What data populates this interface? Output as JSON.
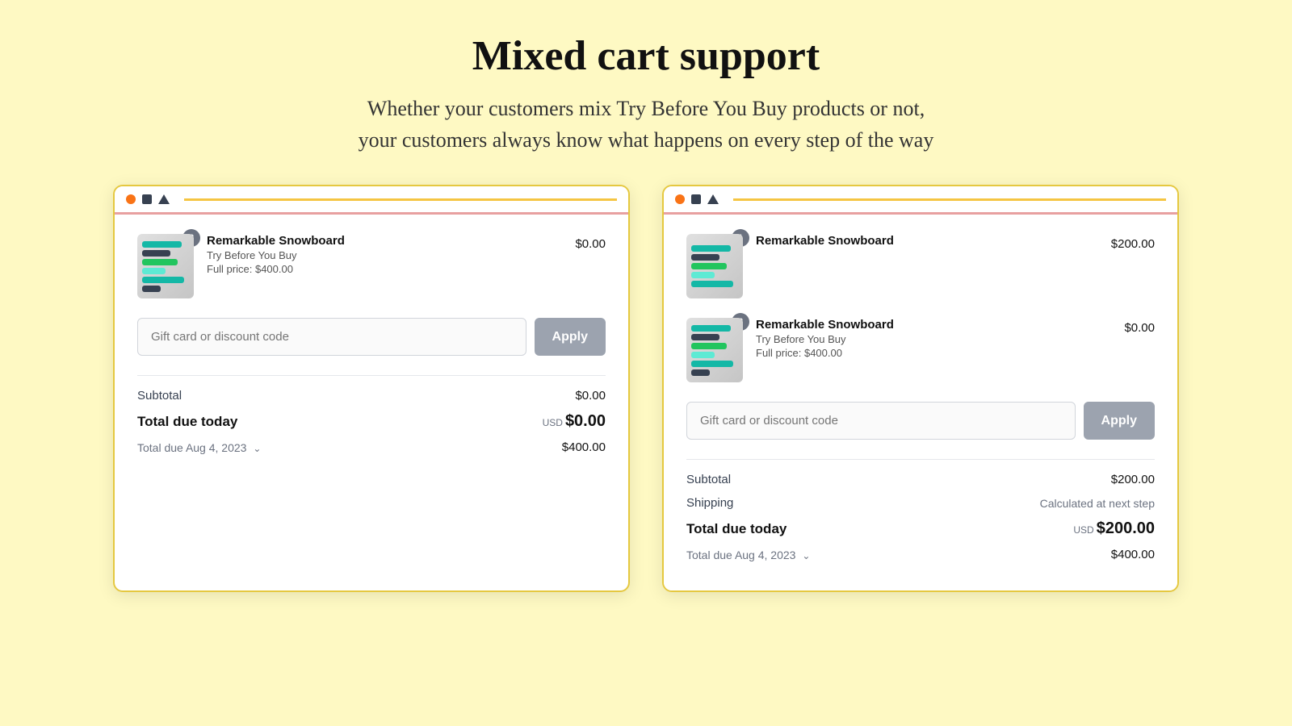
{
  "header": {
    "title": "Mixed cart support",
    "subtitle_line1": "Whether your customers mix Try Before You Buy products or not,",
    "subtitle_line2": "your customers always know what happens on every step of the way"
  },
  "cards": [
    {
      "id": "card-left",
      "products": [
        {
          "name": "Remarkable Snowboard",
          "subtitle": "Try Before You Buy",
          "fullprice": "Full price: $400.00",
          "price": "$0.00",
          "badge": "2"
        }
      ],
      "discount_placeholder": "Gift card or discount code",
      "apply_label": "Apply",
      "summary": {
        "subtotal_label": "Subtotal",
        "subtotal_value": "$0.00",
        "total_due_today_label": "Total due today",
        "total_due_today_usd": "USD",
        "total_due_today_value": "$0.00",
        "deferred_label": "Total due Aug 4, 2023",
        "deferred_value": "$400.00"
      }
    },
    {
      "id": "card-right",
      "products": [
        {
          "name": "Remarkable Snowboard",
          "subtitle": "",
          "fullprice": "",
          "price": "$200.00",
          "badge": "1"
        },
        {
          "name": "Remarkable Snowboard",
          "subtitle": "Try Before You Buy",
          "fullprice": "Full price: $400.00",
          "price": "$0.00",
          "badge": "2"
        }
      ],
      "discount_placeholder": "Gift card or discount code",
      "apply_label": "Apply",
      "summary": {
        "subtotal_label": "Subtotal",
        "subtotal_value": "$200.00",
        "shipping_label": "Shipping",
        "shipping_value": "Calculated at next step",
        "total_due_today_label": "Total due today",
        "total_due_today_usd": "USD",
        "total_due_today_value": "$200.00",
        "deferred_label": "Total due Aug 4, 2023",
        "deferred_value": "$400.00"
      }
    }
  ]
}
